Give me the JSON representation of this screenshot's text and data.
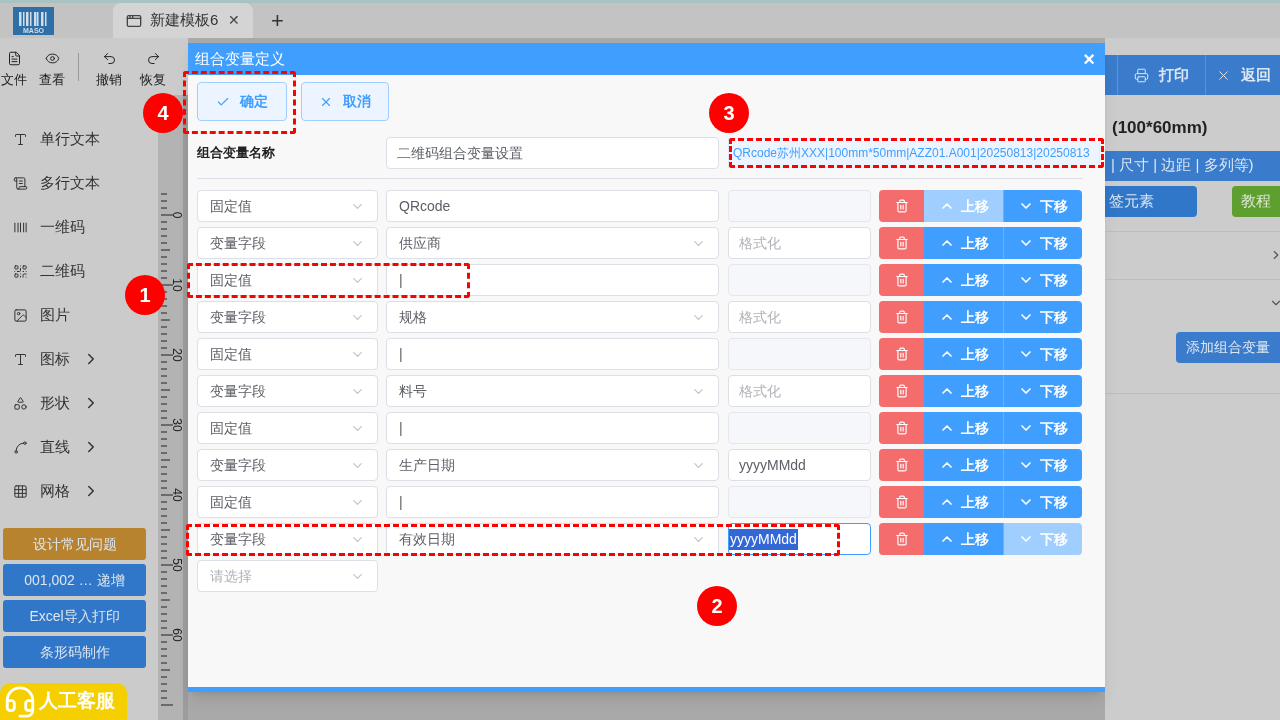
{
  "app_tabs": {
    "logo": "MASO",
    "tab": {
      "title": "新建模板6",
      "close": "✕",
      "selected": true
    },
    "add": "+"
  },
  "toolbar": [
    {
      "label": "文件"
    },
    {
      "label": "查看"
    },
    {
      "label": "撤销"
    },
    {
      "label": "恢复"
    }
  ],
  "sidebar": {
    "items": [
      {
        "label": "单行文本",
        "submenu": false
      },
      {
        "label": "多行文本",
        "submenu": false
      },
      {
        "label": "一维码",
        "submenu": false
      },
      {
        "label": "二维码",
        "submenu": false
      },
      {
        "label": "图片",
        "submenu": false
      },
      {
        "label": "图标",
        "submenu": true
      },
      {
        "label": "形状",
        "submenu": true
      },
      {
        "label": "直线",
        "submenu": true
      },
      {
        "label": "网格",
        "submenu": true
      }
    ],
    "buttons": [
      {
        "label": "设计常见问题",
        "color": "#b8832f"
      },
      {
        "label": "001,002 … 递增",
        "color": "#3177c9"
      },
      {
        "label": "Excel导入打印",
        "color": "#3177c9"
      },
      {
        "label": "条形码制作",
        "color": "#3177c9"
      }
    ],
    "support": "人工客服"
  },
  "ruler": {
    "labels": [
      "0",
      "10",
      "20",
      "30",
      "40",
      "50",
      "60"
    ]
  },
  "right_panel": {
    "toolbar": [
      {
        "label": "打印"
      },
      {
        "label": "返回"
      }
    ],
    "title": "(100*60mm)",
    "info_bar": "| 尺寸 | 边距 | 多列等)",
    "buttons": [
      {
        "label": "签元素",
        "color": "#3177c9"
      },
      {
        "label": "教程",
        "color": "#5e9f30"
      }
    ],
    "sections": [
      {
        "expanded": false
      },
      {
        "expanded": true
      }
    ],
    "add_button": "添加组合变量"
  },
  "dialog": {
    "title": "组合变量定义",
    "close": "×",
    "confirm": "确定",
    "cancel": "取消",
    "name_label": "组合变量名称",
    "name_value": "二维码组合变量设置",
    "preview": "QRcode苏州XXX|100mm*50mm|AZZ01.A001|20250813|20250813",
    "rows": [
      {
        "kind": "fixed",
        "type": "固定值",
        "value": "QRcode",
        "up": {
          "label": "上移",
          "disabled": true
        },
        "down": {
          "label": "下移",
          "disabled": false
        }
      },
      {
        "kind": "field",
        "type": "变量字段",
        "value": "供应商",
        "format_placeholder": "格式化",
        "up": {
          "label": "上移",
          "disabled": false
        },
        "down": {
          "label": "下移",
          "disabled": false
        }
      },
      {
        "kind": "fixed",
        "type": "固定值",
        "value": "|",
        "up": {
          "label": "上移",
          "disabled": false
        },
        "down": {
          "label": "下移",
          "disabled": false
        }
      },
      {
        "kind": "field",
        "type": "变量字段",
        "value": "规格",
        "format_placeholder": "格式化",
        "up": {
          "label": "上移",
          "disabled": false
        },
        "down": {
          "label": "下移",
          "disabled": false
        }
      },
      {
        "kind": "fixed",
        "type": "固定值",
        "value": "|",
        "up": {
          "label": "上移",
          "disabled": false
        },
        "down": {
          "label": "下移",
          "disabled": false
        }
      },
      {
        "kind": "field",
        "type": "变量字段",
        "value": "料号",
        "format_placeholder": "格式化",
        "up": {
          "label": "上移",
          "disabled": false
        },
        "down": {
          "label": "下移",
          "disabled": false
        }
      },
      {
        "kind": "fixed",
        "type": "固定值",
        "value": "|",
        "up": {
          "label": "上移",
          "disabled": false
        },
        "down": {
          "label": "下移",
          "disabled": false
        }
      },
      {
        "kind": "field",
        "type": "变量字段",
        "value": "生产日期",
        "format": "yyyyMMdd",
        "format_selected": false,
        "up": {
          "label": "上移",
          "disabled": false
        },
        "down": {
          "label": "下移",
          "disabled": false
        }
      },
      {
        "kind": "fixed",
        "type": "固定值",
        "value": "|",
        "up": {
          "label": "上移",
          "disabled": false
        },
        "down": {
          "label": "下移",
          "disabled": false
        }
      },
      {
        "kind": "field",
        "type": "变量字段",
        "value": "有效日期",
        "format": "yyyyMMdd",
        "format_selected": true,
        "up": {
          "label": "上移",
          "disabled": false
        },
        "down": {
          "label": "下移",
          "disabled": true
        }
      },
      {
        "kind": "empty",
        "placeholder": "请选择"
      }
    ]
  },
  "annotations": [
    {
      "label": "1"
    },
    {
      "label": "2"
    },
    {
      "label": "3"
    },
    {
      "label": "4"
    }
  ]
}
